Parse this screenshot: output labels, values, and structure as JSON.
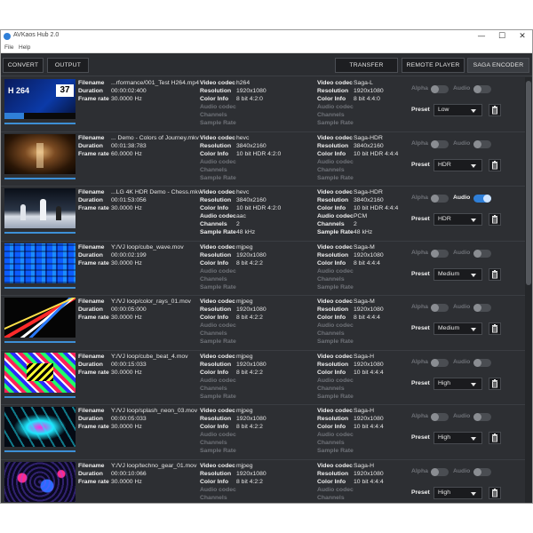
{
  "window": {
    "title": "AVKaos Hub 2.0",
    "controls": {
      "minimize": "—",
      "maximize": "☐",
      "close": "✕"
    }
  },
  "menu": [
    "File",
    "Help"
  ],
  "toolbar": {
    "convert": "CONVERT",
    "output": "OUTPUT",
    "transfer": "TRANSFER",
    "remote_player": "REMOTE PLAYER",
    "saga_encoder": "SAGA ENCODER"
  },
  "labels": {
    "filename": "Filename",
    "duration": "Duration",
    "frame_rate": "Frame rate",
    "video_codec": "Video codec",
    "resolution": "Resolution",
    "color_info": "Color Info",
    "audio_codec": "Audio codec",
    "channels": "Channels",
    "sample_rate": "Sample Rate",
    "alpha": "Alpha",
    "audio": "Audio",
    "preset": "Preset"
  },
  "accent_color": "#2f7fd8",
  "files": [
    {
      "filename": "...rformance/001_Test H264.mp4",
      "duration": "00:00:02:400",
      "frame_rate": "30.0000 Hz",
      "in": {
        "video_codec": "h264",
        "resolution": "1920x1080",
        "color_info": "8 bit 4:2:0",
        "audio_codec": "",
        "channels": "",
        "sample_rate": ""
      },
      "out": {
        "video_codec": "Saga-L",
        "resolution": "1920x1080",
        "color_info": "8 bit 4:4:0"
      },
      "alpha_on": false,
      "audio_on": false,
      "preset": "Low",
      "thumb_text": "H 264",
      "thumb_number": "37"
    },
    {
      "filename": "... Demo - Colors of Journey.mkv",
      "duration": "00:01:38:783",
      "frame_rate": "60.0000 Hz",
      "in": {
        "video_codec": "hevc",
        "resolution": "3840x2160",
        "color_info": "10 bit HDR 4:2:0",
        "audio_codec": "",
        "channels": "",
        "sample_rate": ""
      },
      "out": {
        "video_codec": "Saga-HDR",
        "resolution": "3840x2160",
        "color_info": "10 bit HDR 4:4:4"
      },
      "alpha_on": false,
      "audio_on": false,
      "preset": "HDR"
    },
    {
      "filename": "...LG 4K HDR Demo - Chess.mkv",
      "duration": "00:01:53:056",
      "frame_rate": "30.0000 Hz",
      "in": {
        "video_codec": "hevc",
        "resolution": "3840x2160",
        "color_info": "10 bit HDR 4:2:0",
        "audio_codec": "aac",
        "channels": "2",
        "sample_rate": "48 kHz"
      },
      "out": {
        "video_codec": "Saga-HDR",
        "resolution": "3840x2160",
        "color_info": "10 bit HDR 4:4:4",
        "audio_codec": "PCM",
        "channels": "2",
        "sample_rate": "48 kHz"
      },
      "alpha_on": false,
      "audio_on": true,
      "preset": "HDR"
    },
    {
      "filename": "Y:/VJ loop/cube_wave.mov",
      "duration": "00:00:02:199",
      "frame_rate": "30.0000 Hz",
      "in": {
        "video_codec": "mjpeg",
        "resolution": "1920x1080",
        "color_info": "8 bit 4:2:2",
        "audio_codec": "",
        "channels": "",
        "sample_rate": ""
      },
      "out": {
        "video_codec": "Saga-M",
        "resolution": "1920x1080",
        "color_info": "8 bit 4:4:4"
      },
      "alpha_on": false,
      "audio_on": false,
      "preset": "Medium"
    },
    {
      "filename": "Y:/VJ loop/color_rays_01.mov",
      "duration": "00:00:05:000",
      "frame_rate": "30.0000 Hz",
      "in": {
        "video_codec": "mjpeg",
        "resolution": "1920x1080",
        "color_info": "8 bit 4:2:2",
        "audio_codec": "",
        "channels": "",
        "sample_rate": ""
      },
      "out": {
        "video_codec": "Saga-M",
        "resolution": "1920x1080",
        "color_info": "8 bit 4:4:4"
      },
      "alpha_on": false,
      "audio_on": false,
      "preset": "Medium"
    },
    {
      "filename": "Y:/VJ loop/cube_beat_4.mov",
      "duration": "00:00:15:033",
      "frame_rate": "30.0000 Hz",
      "in": {
        "video_codec": "mjpeg",
        "resolution": "1920x1080",
        "color_info": "8 bit 4:2:2",
        "audio_codec": "",
        "channels": "",
        "sample_rate": ""
      },
      "out": {
        "video_codec": "Saga-H",
        "resolution": "1920x1080",
        "color_info": "10 bit 4:4:4"
      },
      "alpha_on": false,
      "audio_on": false,
      "preset": "High"
    },
    {
      "filename": "Y:/VJ loop/splash_neon_03.mov",
      "duration": "00:00:05:033",
      "frame_rate": "30.0000 Hz",
      "in": {
        "video_codec": "mjpeg",
        "resolution": "1920x1080",
        "color_info": "8 bit 4:2:2",
        "audio_codec": "",
        "channels": "",
        "sample_rate": ""
      },
      "out": {
        "video_codec": "Saga-H",
        "resolution": "1920x1080",
        "color_info": "10 bit 4:4:4"
      },
      "alpha_on": false,
      "audio_on": false,
      "preset": "High"
    },
    {
      "filename": "Y:/VJ loop/techno_gear_01.mov",
      "duration": "00:00:10:066",
      "frame_rate": "30.0000 Hz",
      "in": {
        "video_codec": "mjpeg",
        "resolution": "1920x1080",
        "color_info": "8 bit 4:2:2",
        "audio_codec": "",
        "channels": "",
        "sample_rate": ""
      },
      "out": {
        "video_codec": "Saga-H",
        "resolution": "1920x1080",
        "color_info": "10 bit 4:4:4"
      },
      "alpha_on": false,
      "audio_on": false,
      "preset": "High"
    }
  ]
}
